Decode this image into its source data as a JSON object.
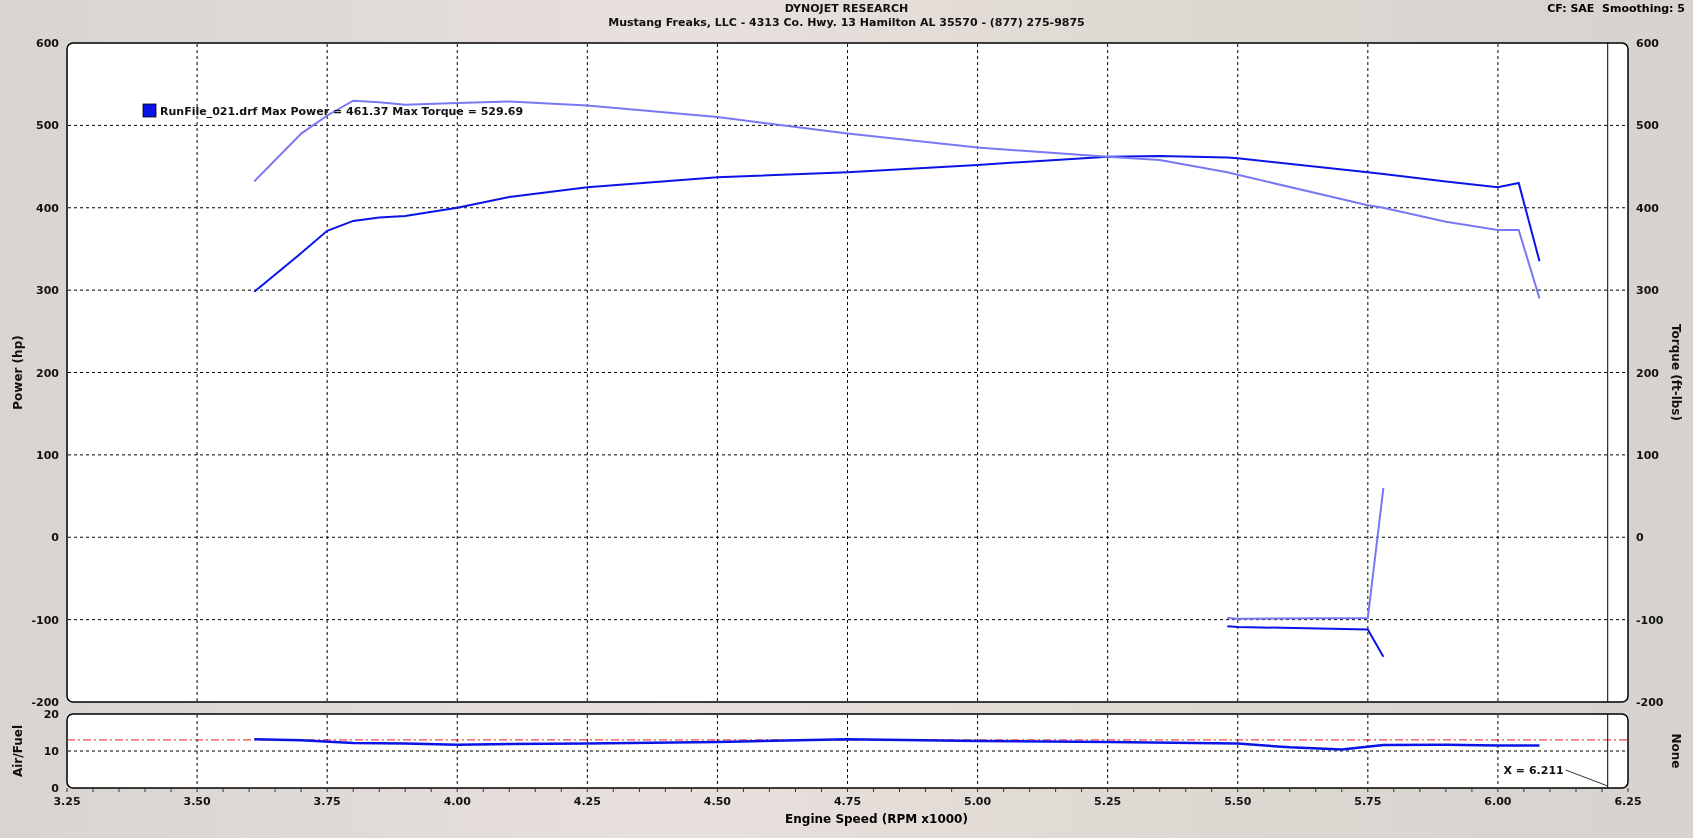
{
  "header": {
    "title": "DYNOJET RESEARCH",
    "subtitle": "Mustang Freaks, LLC - 4313 Co. Hwy. 13 Hamilton AL 35570 - (877) 275-9875",
    "settings": "CF: SAE  Smoothing: 5"
  },
  "power_chart": {
    "legend": "RunFile_021.drf Max Power = 461.37 Max Torque = 529.69",
    "right_ylabel": "Torque (ft-lbs)",
    "left_tick_labels": [
      "600",
      "500",
      "400",
      "300",
      "200",
      "100",
      "0",
      "-100",
      "-200"
    ],
    "right_tick_labels": [
      "600",
      "500",
      "400",
      "300",
      "200",
      "100",
      "0",
      "-100",
      "-200"
    ],
    "chart_data": {
      "type": "line",
      "ylabel": "Power (hp)",
      "xlim": [
        3.25,
        6.25
      ],
      "ylim": [
        -200,
        600
      ],
      "grid": true,
      "yticks": [
        -200,
        -100,
        0,
        100,
        200,
        300,
        400,
        500,
        600
      ],
      "x": [
        3.61,
        3.7,
        3.75,
        3.8,
        3.85,
        3.9,
        4.0,
        4.1,
        4.25,
        4.5,
        4.75,
        5.0,
        5.25,
        5.35,
        5.48,
        5.5,
        5.75,
        5.78,
        5.9,
        6.0,
        6.04,
        6.08
      ],
      "series": [
        {
          "color": "#0a14e6",
          "values": [
            298,
            345,
            372,
            384,
            388,
            390,
            400,
            413,
            425,
            437,
            443,
            452,
            462,
            463,
            461,
            460,
            443,
            441,
            432,
            425,
            430,
            335
          ]
        },
        {
          "color": "#7878f5",
          "values": [
            432,
            490,
            512,
            530,
            528,
            525,
            527,
            529,
            524,
            510,
            490,
            473,
            462,
            458,
            443,
            440,
            403,
            400,
            383,
            373,
            373,
            290
          ]
        },
        {
          "color": "#0a14e6",
          "values": [
            null,
            null,
            null,
            null,
            null,
            null,
            null,
            null,
            null,
            null,
            null,
            null,
            null,
            null,
            -108,
            -109,
            -112,
            -145,
            null,
            null,
            null,
            null
          ]
        },
        {
          "color": "#7878f5",
          "values": [
            null,
            null,
            null,
            null,
            null,
            null,
            null,
            null,
            null,
            null,
            null,
            null,
            null,
            null,
            -98,
            -99,
            -98,
            60,
            null,
            null,
            null,
            null
          ]
        }
      ],
      "ref_lines": [
        {
          "axis": "x",
          "value": 6.211
        }
      ]
    }
  },
  "afr_chart": {
    "right_label": "None",
    "cursor_label": "X = 6.211",
    "chart_data": {
      "type": "line",
      "ylabel": "Air/Fuel",
      "xlabel": "Engine Speed (RPM x1000)",
      "xlim": [
        3.25,
        6.25
      ],
      "ylim": [
        0,
        20
      ],
      "grid": true,
      "yticks": [
        0,
        10,
        20
      ],
      "xticks": [
        {
          "value": 3.25,
          "label": "3.25"
        },
        {
          "value": 3.5,
          "label": "3.50"
        },
        {
          "value": 3.75,
          "label": "3.75"
        },
        {
          "value": 4,
          "label": "4.00"
        },
        {
          "value": 4.25,
          "label": "4.25"
        },
        {
          "value": 4.5,
          "label": "4.50"
        },
        {
          "value": 4.75,
          "label": "4.75"
        },
        {
          "value": 5,
          "label": "5.00"
        },
        {
          "value": 5.25,
          "label": "5.25"
        },
        {
          "value": 5.5,
          "label": "5.50"
        },
        {
          "value": 5.75,
          "label": "5.75"
        },
        {
          "value": 6,
          "label": "6.00"
        },
        {
          "value": 6.25,
          "label": "6.25"
        }
      ],
      "x": [
        3.61,
        3.7,
        3.8,
        3.9,
        4.0,
        4.1,
        4.25,
        4.5,
        4.75,
        5.0,
        5.25,
        5.5,
        5.6,
        5.7,
        5.78,
        5.9,
        6.0,
        6.08
      ],
      "series": [
        {
          "color": "#0a14e6",
          "values": [
            13.2,
            12.9,
            12.2,
            12.0,
            11.7,
            11.9,
            12.0,
            12.4,
            13.2,
            12.7,
            12.4,
            12.0,
            11.0,
            10.4,
            11.6,
            11.7,
            11.5,
            11.5
          ]
        }
      ],
      "ref_lines": [
        {
          "axis": "y",
          "value": 13
        },
        {
          "axis": "x",
          "value": 6.211
        }
      ]
    }
  }
}
